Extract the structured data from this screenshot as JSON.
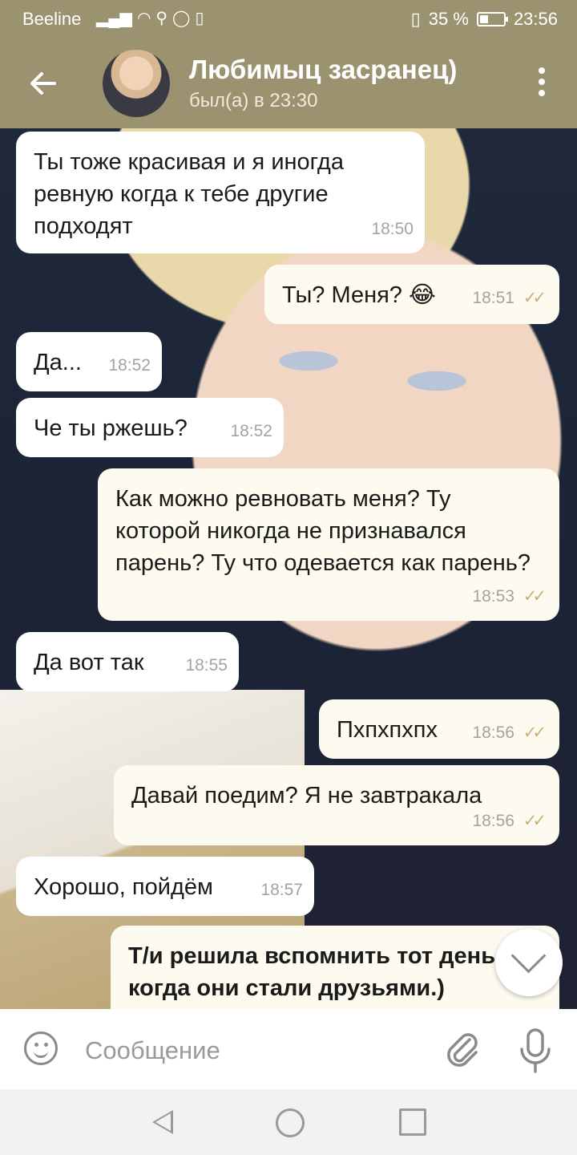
{
  "status_bar": {
    "carrier": "Beeline",
    "battery_percent": "35 %",
    "battery_level": 0.35,
    "time": "23:56"
  },
  "header": {
    "contact_name": "Любимыц засранец)",
    "last_seen": "был(а) в 23:30",
    "back_icon": "arrow-left-icon",
    "menu_icon": "more-vert-icon"
  },
  "messages": [
    {
      "dir": "in",
      "text": "Ты тоже красивая и я иногда ревную когда к тебе другие подходят",
      "time": "18:50"
    },
    {
      "dir": "out",
      "text": "Ты? Меня? 😂",
      "time": "18:51",
      "read": "✓✓"
    },
    {
      "dir": "in",
      "text": "Да...",
      "time": "18:52"
    },
    {
      "dir": "in",
      "text": "Че ты ржешь?",
      "time": "18:52"
    },
    {
      "dir": "out",
      "text": "Как можно ревновать меня? Ту которой никогда не признавался парень? Ту что одевается как парень?",
      "time": "18:53",
      "read": "✓✓"
    },
    {
      "dir": "in",
      "text": "Да вот так",
      "time": "18:55"
    },
    {
      "dir": "out",
      "text": "Пхпхпхпх",
      "time": "18:56",
      "read": "✓✓"
    },
    {
      "dir": "out",
      "text": "Давай поедим? Я не завтракала",
      "time": "18:56",
      "read": "✓✓"
    },
    {
      "dir": "in",
      "text": "Хорошо, пойдём",
      "time": "18:57"
    },
    {
      "dir": "out",
      "text": "Т/и решила вспомнить тот день когда они стали друзьями.)"
    }
  ],
  "input": {
    "placeholder": "Сообщение"
  },
  "colors": {
    "header": "#9b9370",
    "incoming_bubble": "#ffffff",
    "outgoing_bubble": "#fdfbef",
    "read_ticks": "#c9b27a"
  }
}
